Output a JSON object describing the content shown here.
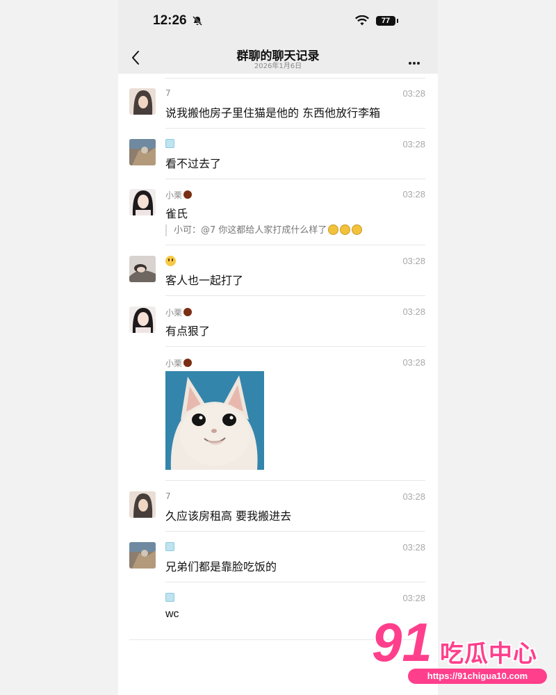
{
  "status_bar": {
    "time": "12:26",
    "battery": "77",
    "icons": [
      "bell-muted-icon",
      "wifi-icon",
      "battery-icon"
    ]
  },
  "nav": {
    "title": "群聊的聊天记录",
    "subtitle": "2026年1月6日",
    "back_icon": "chevron-left-icon",
    "more_icon": "more-dots-icon"
  },
  "messages": [
    {
      "sender": "7",
      "time": "03:28",
      "text": "说我搬他房子里住猫是他的 东西他放行李箱"
    },
    {
      "sender": "",
      "sender_emoji": "ice-cube-emoji",
      "time": "03:28",
      "text": "看不过去了"
    },
    {
      "sender": "小栗",
      "sender_emoji": "chestnut-emoji",
      "time": "03:28",
      "text": "雀氏",
      "quote_sender": "小可：",
      "quote": "@7 你这都给人家打成什么样了"
    },
    {
      "sender": "",
      "sender_emoji": "smile-emoji",
      "time": "03:28",
      "text": "客人也一起打了"
    },
    {
      "sender": "小栗",
      "sender_emoji": "chestnut-emoji",
      "time": "03:28",
      "text": "有点狠了"
    },
    {
      "sender": "小栗",
      "sender_emoji": "chestnut-emoji",
      "time": "03:28",
      "image": "smirking-cat-sticker"
    },
    {
      "sender": "7",
      "time": "03:28",
      "text": "久应该房租高 要我搬进去"
    },
    {
      "sender": "",
      "sender_emoji": "ice-cube-emoji",
      "time": "03:28",
      "text": "兄弟们都是靠脸吃饭的"
    },
    {
      "sender": "",
      "sender_emoji": "ice-cube-emoji",
      "time": "03:28",
      "text": "wc"
    }
  ],
  "watermark": {
    "number": "91",
    "name": "吃瓜中心",
    "url": "https://91chigua10.com"
  },
  "colors": {
    "accent": "#ff3f8c",
    "header_bg": "#ededed",
    "page_bg": "#ffffff"
  }
}
